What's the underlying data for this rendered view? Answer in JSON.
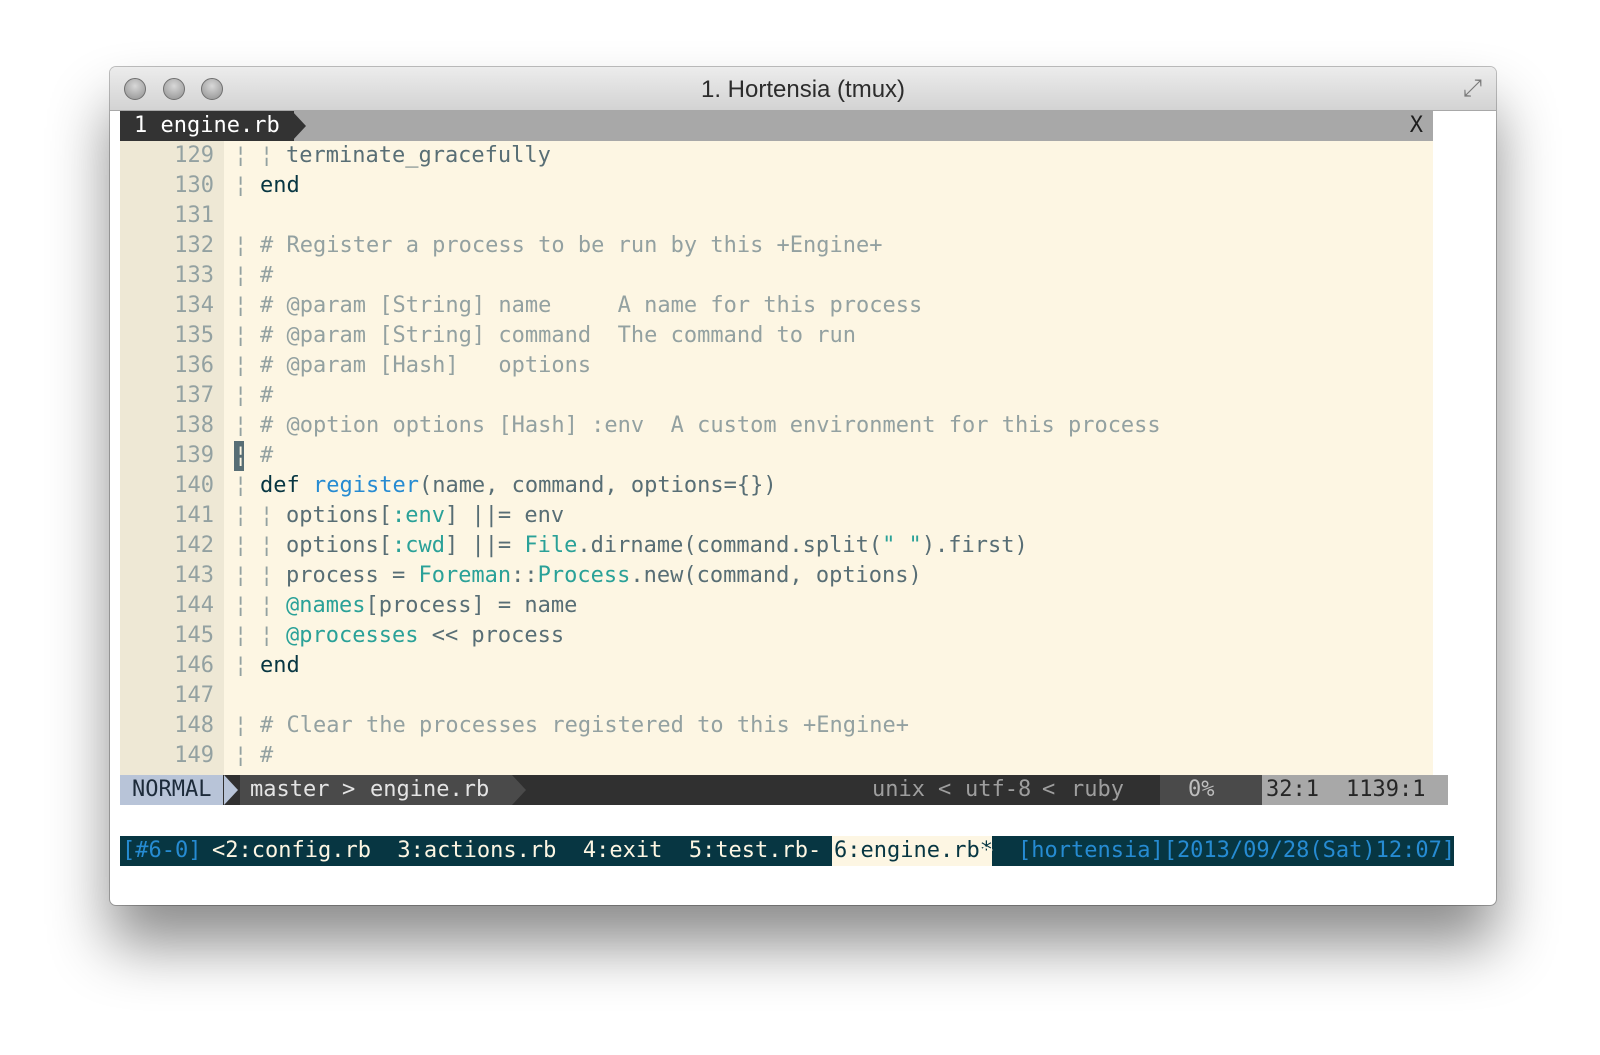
{
  "window": {
    "title": "1. Hortensia (tmux)"
  },
  "tabline": {
    "buffer_tab": "1 engine.rb",
    "close_label": "X"
  },
  "code": [
    {
      "n": "129",
      "g": "¦",
      "g2": "¦",
      "parts": [
        {
          "t": "terminate_gracefully",
          "c": ""
        }
      ],
      "indent": 2
    },
    {
      "n": "130",
      "g": "¦",
      "parts": [
        {
          "t": "end",
          "c": "kw"
        }
      ],
      "indent": 1
    },
    {
      "n": "131",
      "g": "",
      "parts": [],
      "indent": 1
    },
    {
      "n": "132",
      "g": "¦",
      "parts": [
        {
          "t": "# Register a process to be run by this +Engine+",
          "c": "cmt"
        }
      ],
      "indent": 1
    },
    {
      "n": "133",
      "g": "¦",
      "parts": [
        {
          "t": "#",
          "c": "cmt"
        }
      ],
      "indent": 1
    },
    {
      "n": "134",
      "g": "¦",
      "parts": [
        {
          "t": "# @param [String] name     A name for this process",
          "c": "cmt"
        }
      ],
      "indent": 1
    },
    {
      "n": "135",
      "g": "¦",
      "parts": [
        {
          "t": "# @param [String] command  The command to run",
          "c": "cmt"
        }
      ],
      "indent": 1
    },
    {
      "n": "136",
      "g": "¦",
      "parts": [
        {
          "t": "# @param [Hash]   options",
          "c": "cmt"
        }
      ],
      "indent": 1
    },
    {
      "n": "137",
      "g": "¦",
      "parts": [
        {
          "t": "#",
          "c": "cmt"
        }
      ],
      "indent": 1
    },
    {
      "n": "138",
      "g": "¦",
      "parts": [
        {
          "t": "# @option options [Hash] :env  A custom environment for this process",
          "c": "cmt"
        }
      ],
      "indent": 1
    },
    {
      "n": "139",
      "g": "¦",
      "cursor": true,
      "parts": [
        {
          "t": "#",
          "c": "cmt"
        }
      ],
      "indent": 1
    },
    {
      "n": "140",
      "g": "¦",
      "parts": [
        {
          "t": "def ",
          "c": "kw"
        },
        {
          "t": "register",
          "c": "fn"
        },
        {
          "t": "(name, command, options={})",
          "c": ""
        }
      ],
      "indent": 1
    },
    {
      "n": "141",
      "g": "¦",
      "g2": "¦",
      "parts": [
        {
          "t": "options[",
          "c": ""
        },
        {
          "t": ":env",
          "c": "sym"
        },
        {
          "t": "] ||= env",
          "c": ""
        }
      ],
      "indent": 2
    },
    {
      "n": "142",
      "g": "¦",
      "g2": "¦",
      "parts": [
        {
          "t": "options[",
          "c": ""
        },
        {
          "t": ":cwd",
          "c": "sym"
        },
        {
          "t": "] ||= ",
          "c": ""
        },
        {
          "t": "File",
          "c": "const"
        },
        {
          "t": ".dirname(command.split(",
          "c": ""
        },
        {
          "t": "\" \"",
          "c": "str"
        },
        {
          "t": ").first)",
          "c": ""
        }
      ],
      "indent": 2
    },
    {
      "n": "143",
      "g": "¦",
      "g2": "¦",
      "parts": [
        {
          "t": "process = ",
          "c": ""
        },
        {
          "t": "Foreman",
          "c": "const"
        },
        {
          "t": "::",
          "c": ""
        },
        {
          "t": "Process",
          "c": "const"
        },
        {
          "t": ".new(command, options)",
          "c": ""
        }
      ],
      "indent": 2
    },
    {
      "n": "144",
      "g": "¦",
      "g2": "¦",
      "parts": [
        {
          "t": "@names",
          "c": "ivar"
        },
        {
          "t": "[process] = name",
          "c": ""
        }
      ],
      "indent": 2
    },
    {
      "n": "145",
      "g": "¦",
      "g2": "¦",
      "parts": [
        {
          "t": "@processes",
          "c": "ivar"
        },
        {
          "t": " << process",
          "c": ""
        }
      ],
      "indent": 2
    },
    {
      "n": "146",
      "g": "¦",
      "parts": [
        {
          "t": "end",
          "c": "kw"
        }
      ],
      "indent": 1
    },
    {
      "n": "147",
      "g": "",
      "parts": [],
      "indent": 1
    },
    {
      "n": "148",
      "g": "¦",
      "parts": [
        {
          "t": "# Clear the processes registered to this +Engine+",
          "c": "cmt"
        }
      ],
      "indent": 1
    },
    {
      "n": "149",
      "g": "¦",
      "parts": [
        {
          "t": "#",
          "c": "cmt"
        }
      ],
      "indent": 1
    }
  ],
  "statusline": {
    "mode": "NORMAL",
    "branch": "master",
    "separator": ">",
    "filename": "engine.rb",
    "fileformat": "unix",
    "encoding": "utf-8",
    "filetype": "ruby",
    "percent": "0%",
    "position": "32:1",
    "position2": "1139:1"
  },
  "tmux": {
    "session": "[#6-0]",
    "windows": "<2:config.rb  3:actions.rb  4:exit  5:test.rb-",
    "current": "6:engine.rb*",
    "current_end": ">",
    "right": "[hortensia][2013/09/28(Sat)12:07]"
  },
  "colors": {
    "background": "#fdf6e3",
    "comment": "#93a1a1",
    "accent_blue": "#268bd2",
    "accent_cyan": "#2aa198",
    "tmux_bg": "#073642"
  }
}
